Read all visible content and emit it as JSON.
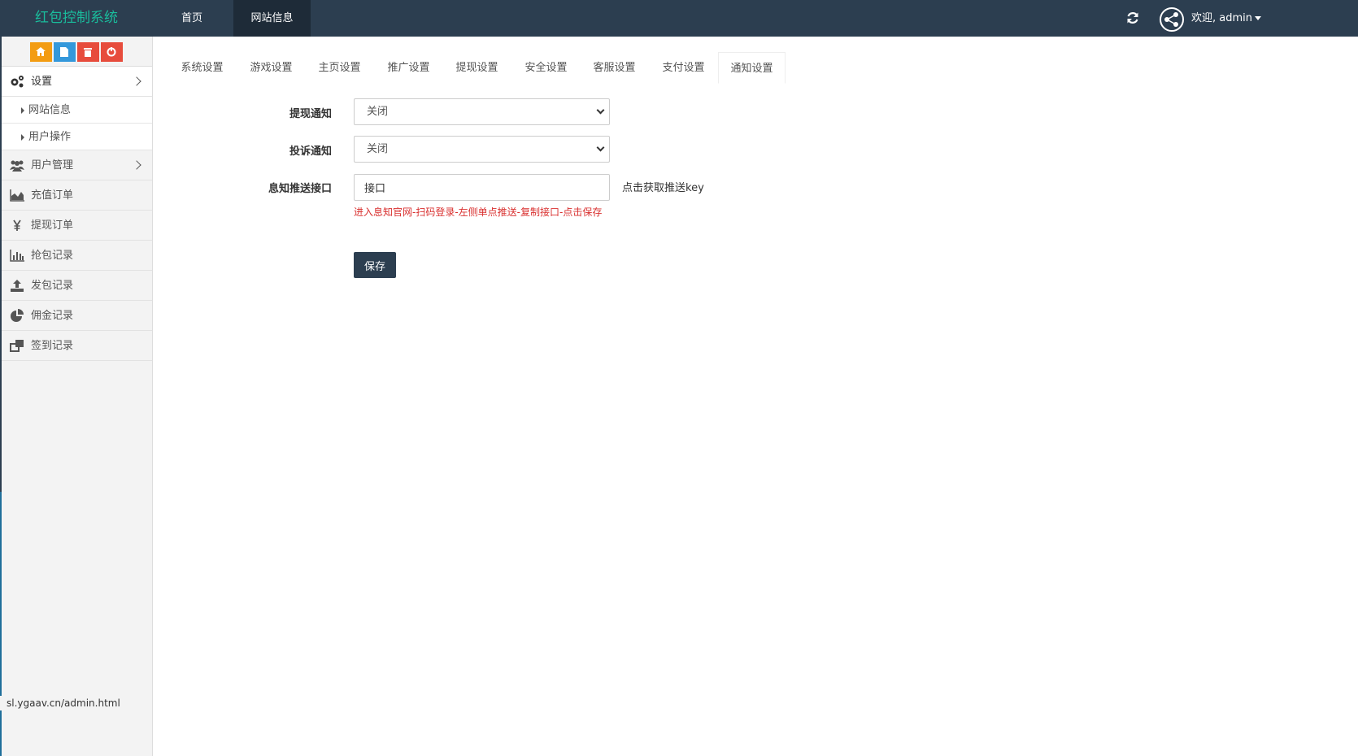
{
  "header": {
    "brand": "红包控制系统",
    "nav": [
      {
        "label": "首页"
      },
      {
        "label": "网站信息",
        "active": true
      }
    ],
    "welcome": "欢迎, admin",
    "bg_color": "#2c3e50",
    "brand_color": "#1abc9c"
  },
  "sidebar": {
    "shortcuts": [
      {
        "icon": "home-icon",
        "color": "#f39c12"
      },
      {
        "icon": "file-icon",
        "color": "#3498db"
      },
      {
        "icon": "trash-icon",
        "color": "#e74c3c"
      },
      {
        "icon": "recycle-icon",
        "color": "#e74c3c"
      }
    ],
    "menu": [
      {
        "label": "设置",
        "icon": "gears-icon",
        "open": true,
        "children": [
          {
            "label": "网站信息"
          },
          {
            "label": "用户操作"
          }
        ]
      },
      {
        "label": "用户管理",
        "icon": "users-icon",
        "has_children": true
      },
      {
        "label": "充值订单",
        "icon": "area-chart-icon"
      },
      {
        "label": "提现订单",
        "icon": "yen-icon"
      },
      {
        "label": "抢包记录",
        "icon": "bar-chart-icon"
      },
      {
        "label": "发包记录",
        "icon": "upload-icon"
      },
      {
        "label": "佣金记录",
        "icon": "pie-chart-icon"
      },
      {
        "label": "签到记录",
        "icon": "windows-icon"
      }
    ]
  },
  "status_url": "sl.ygaav.cn/admin.html",
  "tabs": [
    {
      "label": "系统设置"
    },
    {
      "label": "游戏设置"
    },
    {
      "label": "主页设置"
    },
    {
      "label": "推广设置"
    },
    {
      "label": "提现设置"
    },
    {
      "label": "安全设置"
    },
    {
      "label": "客服设置"
    },
    {
      "label": "支付设置"
    },
    {
      "label": "通知设置",
      "active": true
    }
  ],
  "form": {
    "withdraw_notice": {
      "label": "提现通知",
      "value": "关闭"
    },
    "complaint_notice": {
      "label": "投诉通知",
      "value": "关闭"
    },
    "push_api": {
      "label": "息知推送接口",
      "value": "接口",
      "link": "点击获取推送key",
      "hint": "进入息知官网-扫码登录-左侧单点推送-复制接口-点击保存"
    },
    "save_label": "保存"
  }
}
